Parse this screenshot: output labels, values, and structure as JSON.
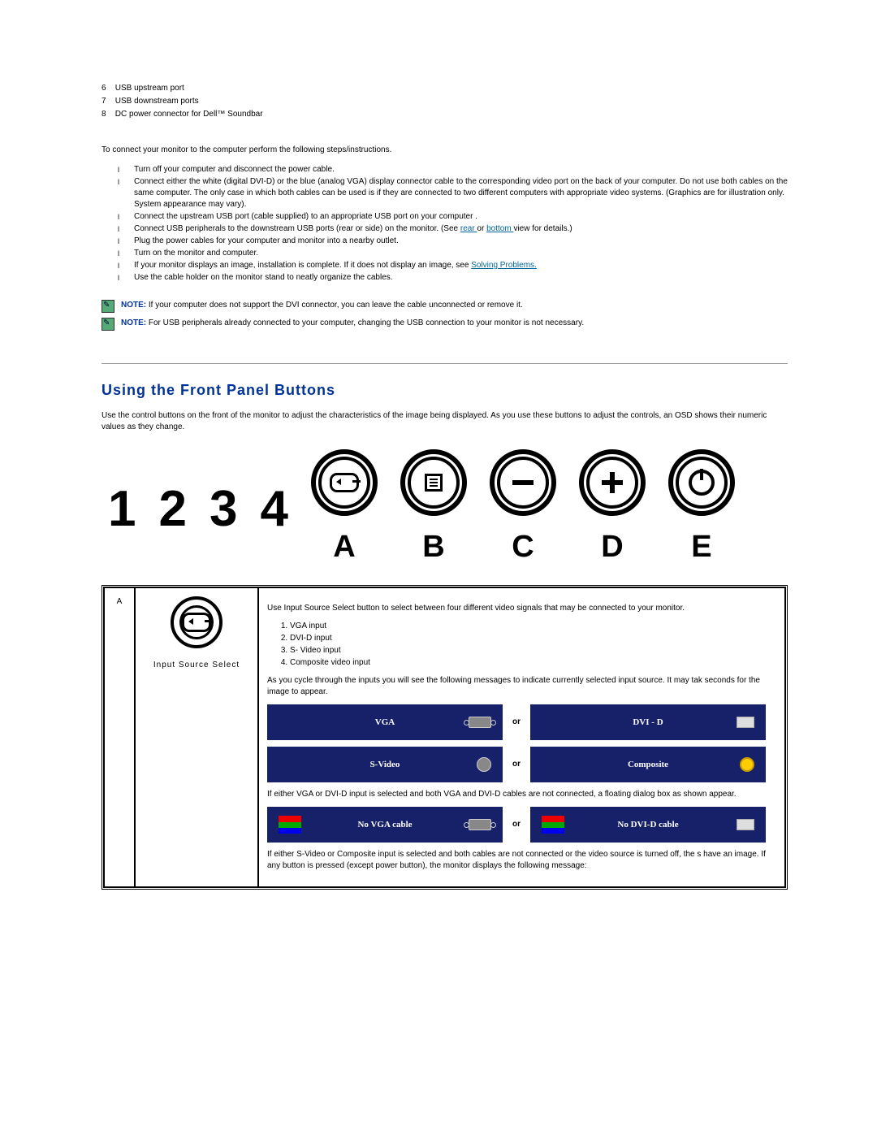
{
  "ports": [
    {
      "n": "6",
      "label": "USB upstream port"
    },
    {
      "n": "7",
      "label": "USB downstream ports"
    },
    {
      "n": "8",
      "label": "DC power connector for Dell™ Soundbar"
    }
  ],
  "connect_intro": "To connect your monitor to the computer perform the following steps/instructions.",
  "steps": [
    "Turn off your computer and disconnect the power cable.",
    "Connect either the white (digital DVI-D) or the blue (analog VGA) display connector cable to the corresponding video port on the back of your computer. Do not use both cables on the same computer. The only case in which both cables can be used is if they are connected to two different computers with appropriate video systems. (Graphics are for illustration only. System appearance may vary).",
    "Connect the upstream USB port (cable supplied) to an appropriate USB port on your computer .",
    "Connect USB peripherals to the downstream USB ports (rear or side) on the monitor. (See ",
    "Plug the power cables for your computer and monitor into a nearby outlet.",
    "Turn on the monitor and computer.",
    "If your monitor displays an image, installation is complete. If it does not display an image, see ",
    "Use the cable holder on the monitor stand to neatly organize the cables."
  ],
  "step4_links": {
    "rear": "rear ",
    "or": "or ",
    "bottom": "bottom ",
    "tail": "view for details.)"
  },
  "step7_link": "Solving Problems.",
  "note1_label": "NOTE:",
  "note1": "If your computer does not support the DVI connector, you can leave the cable unconnected or remove it.",
  "note2_label": "NOTE:",
  "note2": "For USB peripherals already connected to your computer, changing the USB connection to your monitor is not necessary.",
  "section_heading": "Using the Front Panel Buttons",
  "section_intro": "Use the control buttons on the front of the monitor to adjust the characteristics of the image being displayed. As you use these buttons to adjust the controls, an OSD shows their numeric values as they change.",
  "diagram_nums": [
    "1",
    "2",
    "3",
    "4"
  ],
  "diagram_labels": [
    "A",
    "B",
    "C",
    "D",
    "E"
  ],
  "rowA": {
    "letter": "A",
    "icon_caption": "Input Source Select",
    "intro": "Use Input Source Select button to select between four different video signals that may be connected to your monitor.",
    "inputs": [
      "VGA input",
      "DVI-D input",
      "S- Video input",
      "Composite video input"
    ],
    "cycle": "As you cycle through the inputs you will see the following messages to indicate currently selected input source. It may tak seconds for the image to appear.",
    "banner_vga": "VGA",
    "banner_dvid": "DVI - D",
    "banner_svideo": "S-Video",
    "banner_composite": "Composite",
    "or": "or",
    "float1": "If either VGA or DVI-D input is selected and both VGA and DVI-D cables are not connected, a floating dialog box as shown appear.",
    "banner_novga": "No VGA cable",
    "banner_nodvi": "No DVI-D cable",
    "float2": "If either S-Video or Composite input is selected and both cables are not connected or the video source is turned off, the s have an image. If any button is pressed (except power button), the monitor displays the following message:"
  }
}
